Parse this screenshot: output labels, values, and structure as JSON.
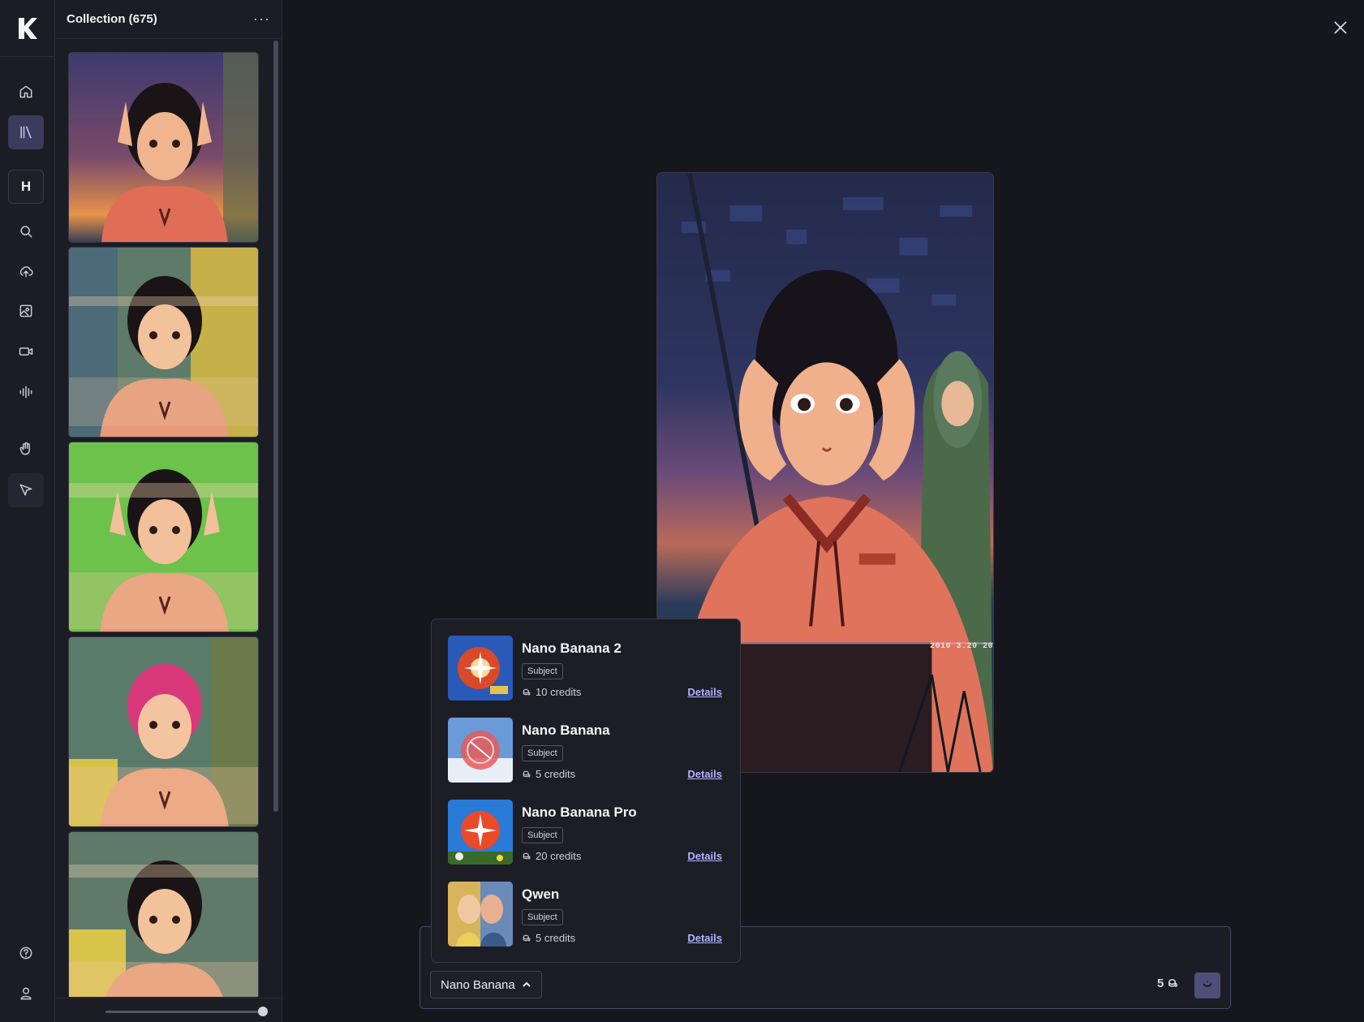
{
  "collection": {
    "title": "Collection (675)",
    "menu_icon": "more-horizontal-icon",
    "thumbnails": [
      {
        "label": "anime-girl-sunset-variant-1"
      },
      {
        "label": "anime-girl-stripes-variant-2"
      },
      {
        "label": "anime-girl-green-variant-3"
      },
      {
        "label": "anime-girl-pink-hair-variant-4"
      },
      {
        "label": "anime-girl-stripes-variant-5"
      }
    ]
  },
  "rail": {
    "logo": "K",
    "h_button": "H",
    "icons": [
      "home-icon",
      "library-icon",
      "search-icon",
      "upload-cloud-icon",
      "image-icon",
      "video-icon",
      "audio-icon",
      "hand-icon",
      "pointer-icon",
      "help-icon",
      "user-icon"
    ]
  },
  "preview": {
    "stamp": "2010 3.20   20"
  },
  "prompt": {
    "selected_model": "Nano Banana",
    "cost": "5"
  },
  "models": [
    {
      "name": "Nano Banana 2",
      "tag": "Subject",
      "credits": "10 credits",
      "details": "Details"
    },
    {
      "name": "Nano Banana",
      "tag": "Subject",
      "credits": "5 credits",
      "details": "Details"
    },
    {
      "name": "Nano Banana Pro",
      "tag": "Subject",
      "credits": "20 credits",
      "details": "Details"
    },
    {
      "name": "Qwen",
      "tag": "Subject",
      "credits": "5 credits",
      "details": "Details"
    }
  ],
  "colors": {
    "background": "#16161d",
    "panel": "#1c1c24",
    "accent": "#3b3c5c",
    "link": "#b0b3ff"
  }
}
